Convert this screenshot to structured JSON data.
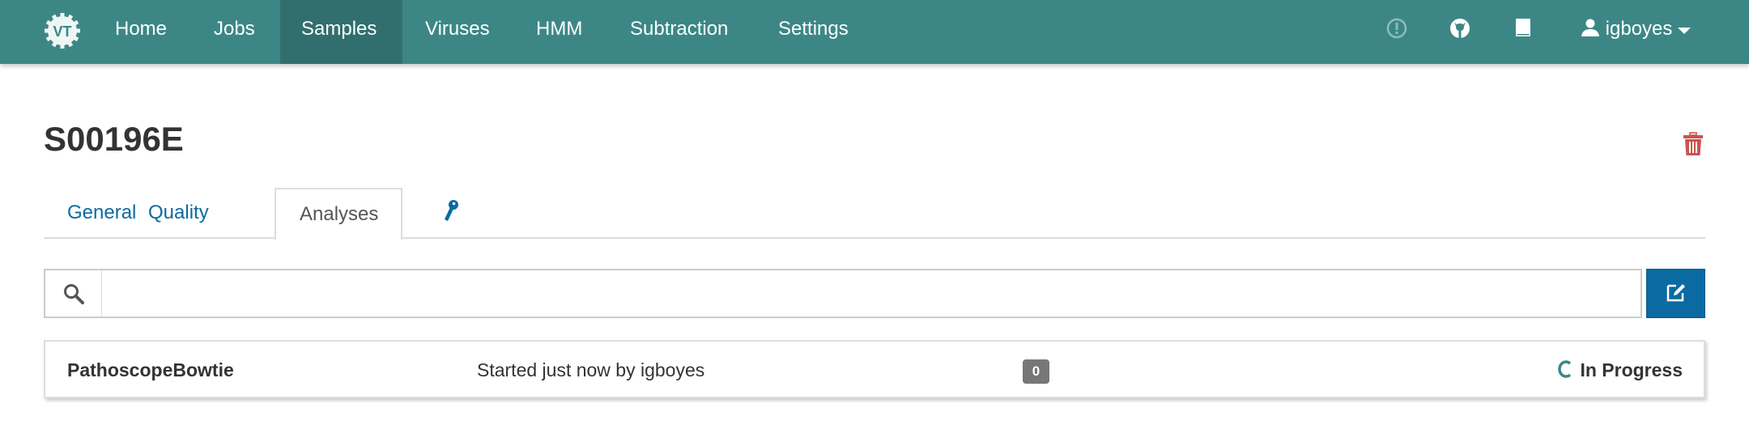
{
  "nav": {
    "logo": "VT",
    "items": [
      {
        "label": "Home"
      },
      {
        "label": "Jobs"
      },
      {
        "label": "Samples",
        "active": true
      },
      {
        "label": "Viruses"
      },
      {
        "label": "HMM"
      },
      {
        "label": "Subtraction"
      },
      {
        "label": "Settings"
      }
    ],
    "user": "igboyes",
    "icons": [
      "exclamation-circle-icon",
      "github-icon",
      "book-icon",
      "user-icon",
      "caret-down-icon"
    ]
  },
  "page": {
    "title": "S00196E"
  },
  "tabs": [
    {
      "label": "General"
    },
    {
      "label": "Quality"
    },
    {
      "label": "Analyses",
      "active": true
    },
    {
      "icon": "key-icon"
    }
  ],
  "search": {
    "value": "",
    "placeholder": ""
  },
  "analyses": [
    {
      "name": "PathoscopeBowtie",
      "started": "Started just now by igboyes",
      "count": "0",
      "status": "In Progress"
    }
  ],
  "colors": {
    "nav": "#3c8786",
    "nav_active": "#316f6e",
    "link": "#0b6aa2",
    "danger": "#c9534f",
    "badge": "#777777"
  }
}
